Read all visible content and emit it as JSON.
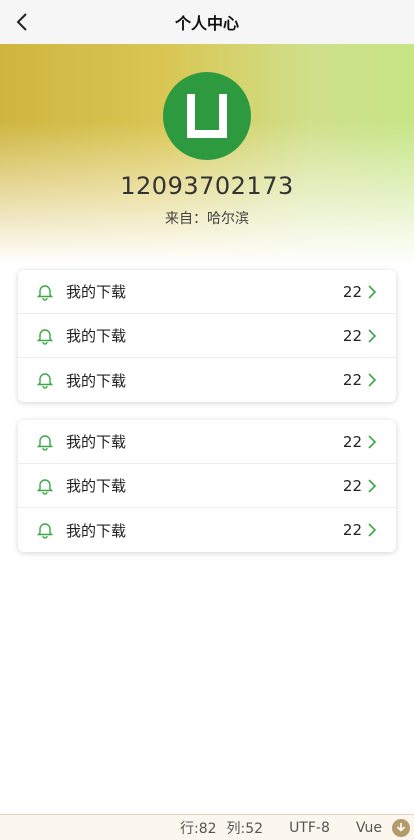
{
  "header": {
    "title": "个人中心",
    "back_icon": "chevron-left-icon"
  },
  "profile": {
    "avatar_icon": "app-logo-icon",
    "avatar_color": "#2e9a40",
    "user_id": "12093702173",
    "location": "来自：哈尔滨"
  },
  "cards": [
    {
      "rows": [
        {
          "icon": "bell-icon",
          "label": "我的下载",
          "count": "22"
        },
        {
          "icon": "bell-icon",
          "label": "我的下载",
          "count": "22"
        },
        {
          "icon": "bell-icon",
          "label": "我的下载",
          "count": "22"
        }
      ]
    },
    {
      "rows": [
        {
          "icon": "bell-icon",
          "label": "我的下载",
          "count": "22"
        },
        {
          "icon": "bell-icon",
          "label": "我的下载",
          "count": "22"
        },
        {
          "icon": "bell-icon",
          "label": "我的下载",
          "count": "22"
        }
      ]
    }
  ],
  "statusbar": {
    "row": "行:82",
    "col": "列:52",
    "encoding": "UTF-8",
    "language": "Vue",
    "download_icon": "download-icon"
  },
  "colors": {
    "accent": "#3aa845",
    "chevron": "#3aa845"
  }
}
